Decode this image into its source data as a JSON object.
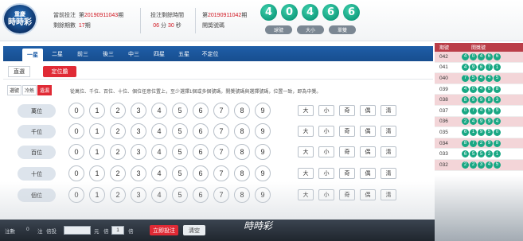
{
  "header": {
    "logo_line1": "重慶",
    "logo_line2": "時時彩",
    "current_label": "當前投注",
    "current_prefix": "第",
    "current_period": "20190911043",
    "current_suffix": "期",
    "remaining_label": "剩餘期數",
    "remaining_count": "17",
    "remaining_suffix": "期",
    "deadline_label": "投注剩餘時間",
    "countdown_min": "06",
    "countdown_min_unit": "分",
    "countdown_sec": "30",
    "countdown_sec_unit": "秒",
    "draw_prefix": "第",
    "draw_period": "20190911042",
    "draw_suffix": "期",
    "draw_label": "開獎號碼",
    "balls": [
      "4",
      "0",
      "4",
      "6",
      "6"
    ],
    "buttons": [
      "球號",
      "大小",
      "單雙"
    ]
  },
  "tabs": [
    "一星",
    "二星",
    "前三",
    "後三",
    "中三",
    "四星",
    "五星",
    "不定位"
  ],
  "active_tab": 0,
  "subtabs": [
    "直選",
    "定位膽"
  ],
  "modes": [
    "選號",
    "冷熱",
    "遺漏"
  ],
  "hint": "從萬位、千位、百位、十位、個位任意位置上，至少選擇1個或多個號碼，開獎號碼與選擇號碼，位置一致，即為中獎。",
  "rows": [
    {
      "label": "萬位"
    },
    {
      "label": "千位"
    },
    {
      "label": "百位"
    },
    {
      "label": "十位"
    },
    {
      "label": "個位"
    }
  ],
  "digits": [
    "0",
    "1",
    "2",
    "3",
    "4",
    "5",
    "6",
    "7",
    "8",
    "9"
  ],
  "filters": [
    "大",
    "小",
    "奇",
    "偶",
    "清"
  ],
  "history": {
    "col_period": "期號",
    "col_numbers": "開獎號",
    "rows": [
      {
        "period": "042",
        "nums": [
          "4",
          "0",
          "4",
          "6",
          "6"
        ]
      },
      {
        "period": "041",
        "nums": [
          "4",
          "9",
          "6",
          "7",
          "1"
        ]
      },
      {
        "period": "040",
        "nums": [
          "7",
          "5",
          "4",
          "4",
          "5"
        ]
      },
      {
        "period": "039",
        "nums": [
          "4",
          "0",
          "4",
          "6",
          "8"
        ]
      },
      {
        "period": "038",
        "nums": [
          "8",
          "9",
          "9",
          "8",
          "3"
        ]
      },
      {
        "period": "037",
        "nums": [
          "0",
          "7",
          "4",
          "5",
          "9"
        ]
      },
      {
        "period": "036",
        "nums": [
          "2",
          "4",
          "9",
          "9",
          "4"
        ]
      },
      {
        "period": "035",
        "nums": [
          "6",
          "1",
          "9",
          "5",
          "0"
        ]
      },
      {
        "period": "034",
        "nums": [
          "8",
          "7",
          "2",
          "9",
          "8"
        ]
      },
      {
        "period": "033",
        "nums": [
          "6",
          "5",
          "5",
          "2",
          "1"
        ]
      },
      {
        "period": "032",
        "nums": [
          "2",
          "2",
          "3",
          "4",
          "5"
        ]
      }
    ]
  },
  "footer": {
    "note_label": "注數",
    "note_count": "0",
    "note_unit": "注",
    "multiplier_label": "倍投",
    "unit_label": "元",
    "mode_label": "倍",
    "multiplier_value": "1",
    "unit2_label": "倍",
    "submit_label": "立即投注",
    "clear_label": "清空",
    "caption": "時時彩"
  }
}
